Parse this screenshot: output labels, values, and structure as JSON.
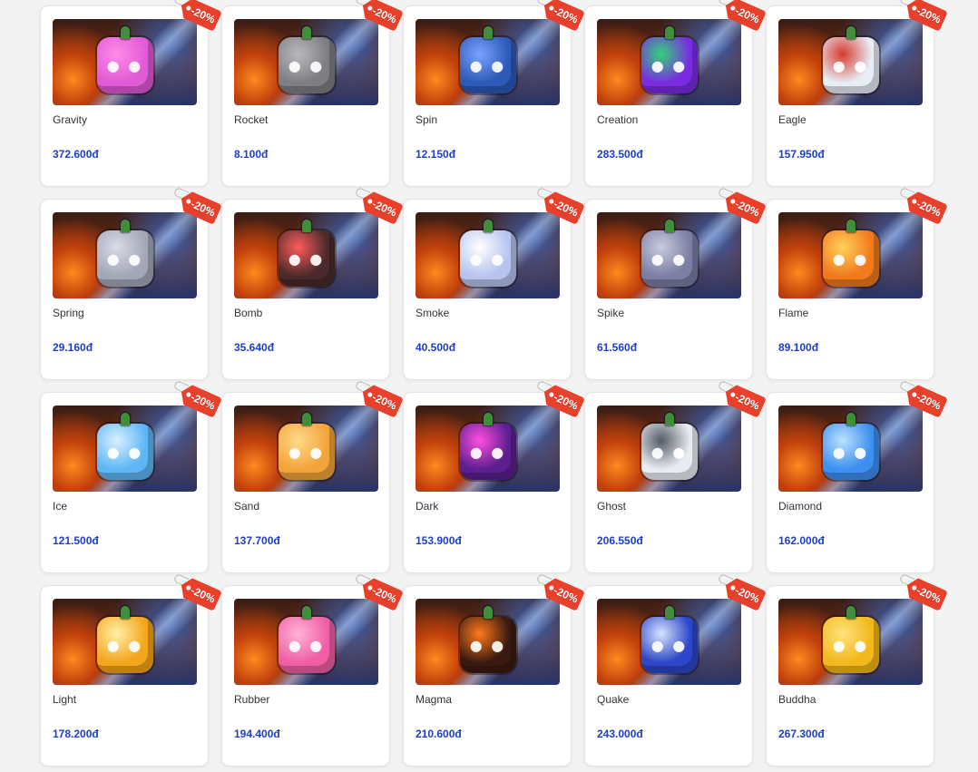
{
  "discount_badge": "-20%",
  "products": [
    {
      "name": "Gravity",
      "price": "372.600đ",
      "icon": "gravity-fruit-icon",
      "color": "#e15ad6",
      "accent": "#ff8be8"
    },
    {
      "name": "Rocket",
      "price": "8.100đ",
      "icon": "rocket-fruit-icon",
      "color": "#7e7e84",
      "accent": "#b9b9bd"
    },
    {
      "name": "Spin",
      "price": "12.150đ",
      "icon": "spin-fruit-icon",
      "color": "#2d59b8",
      "accent": "#7aa3ff"
    },
    {
      "name": "Creation",
      "price": "283.500đ",
      "icon": "creation-fruit-icon",
      "color": "#7a2be2",
      "accent": "#32d27a"
    },
    {
      "name": "Eagle",
      "price": "157.950đ",
      "icon": "eagle-fruit-icon",
      "color": "#e8eef5",
      "accent": "#d83a2f"
    },
    {
      "name": "Spring",
      "price": "29.160đ",
      "icon": "spring-fruit-icon",
      "color": "#a3a7b8",
      "accent": "#d9dbe6"
    },
    {
      "name": "Bomb",
      "price": "35.640đ",
      "icon": "bomb-fruit-icon",
      "color": "#4a2a2a",
      "accent": "#ff5b5b"
    },
    {
      "name": "Smoke",
      "price": "40.500đ",
      "icon": "smoke-fruit-icon",
      "color": "#b7c4ef",
      "accent": "#ffffff"
    },
    {
      "name": "Spike",
      "price": "61.560đ",
      "icon": "spike-fruit-icon",
      "color": "#7b7fa3",
      "accent": "#c9cbe0"
    },
    {
      "name": "Flame",
      "price": "89.100đ",
      "icon": "flame-fruit-icon",
      "color": "#f07a1d",
      "accent": "#ffd15a"
    },
    {
      "name": "Ice",
      "price": "121.500đ",
      "icon": "ice-fruit-icon",
      "color": "#5fb6f5",
      "accent": "#d7f1ff"
    },
    {
      "name": "Sand",
      "price": "137.700đ",
      "icon": "sand-fruit-icon",
      "color": "#f2a43a",
      "accent": "#ffd98a"
    },
    {
      "name": "Dark",
      "price": "153.900đ",
      "icon": "dark-fruit-icon",
      "color": "#5b1f8f",
      "accent": "#ff4fe0"
    },
    {
      "name": "Ghost",
      "price": "206.550đ",
      "icon": "ghost-fruit-icon",
      "color": "#e9edf2",
      "accent": "#555b66"
    },
    {
      "name": "Diamond",
      "price": "162.000đ",
      "icon": "diamond-fruit-icon",
      "color": "#3d8ff0",
      "accent": "#b9e2ff"
    },
    {
      "name": "Light",
      "price": "178.200đ",
      "icon": "light-fruit-icon",
      "color": "#f4a51c",
      "accent": "#fff1a8"
    },
    {
      "name": "Rubber",
      "price": "194.400đ",
      "icon": "rubber-fruit-icon",
      "color": "#f05fa6",
      "accent": "#ffb3d6"
    },
    {
      "name": "Magma",
      "price": "210.600đ",
      "icon": "magma-fruit-icon",
      "color": "#3a1a10",
      "accent": "#ff7a1a"
    },
    {
      "name": "Quake",
      "price": "243.000đ",
      "icon": "quake-fruit-icon",
      "color": "#2c47c9",
      "accent": "#d7e4ff"
    },
    {
      "name": "Buddha",
      "price": "267.300đ",
      "icon": "buddha-fruit-icon",
      "color": "#f2b81c",
      "accent": "#ffe27a"
    }
  ]
}
